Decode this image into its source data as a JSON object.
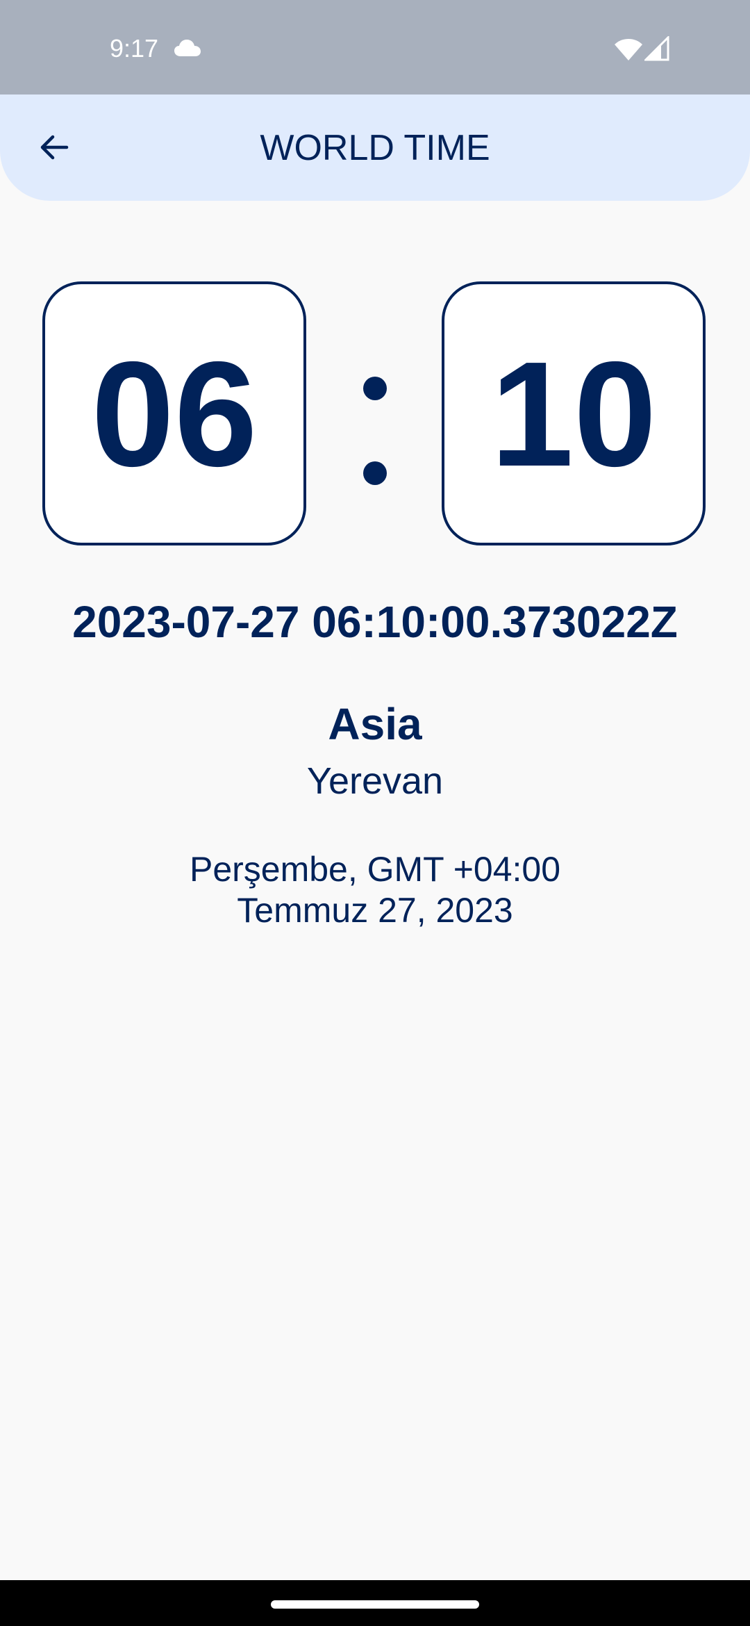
{
  "status_bar": {
    "time": "9:17",
    "icons": [
      "cloud-icon",
      "wifi-icon",
      "signal-icon"
    ]
  },
  "app_bar": {
    "title": "WORLD TIME",
    "back_icon": "arrow-left-icon"
  },
  "clock": {
    "hours": "06",
    "minutes": "10",
    "separator": ":"
  },
  "datetime": "2023-07-27 06:10:00.373022Z",
  "location": {
    "region": "Asia",
    "city": "Yerevan"
  },
  "details": {
    "day_and_offset": "Perşembe, GMT +04:00",
    "date": "Temmuz 27, 2023"
  },
  "colors": {
    "primary": "#012259",
    "app_bar_bg": "#e0ebfd",
    "status_bar_bg": "#a8b0bd",
    "page_bg": "#f9f9f9",
    "card_bg": "#ffffff"
  }
}
